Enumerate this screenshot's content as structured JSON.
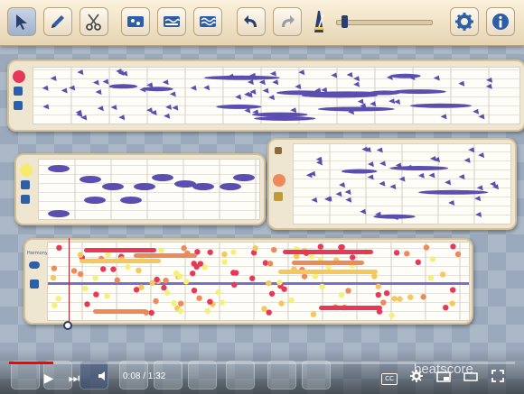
{
  "toolbar": {
    "tools": [
      {
        "name": "select-tool",
        "icon": "arrow-cursor-icon",
        "selected": true
      },
      {
        "name": "pencil-tool",
        "icon": "pencil-icon",
        "selected": false
      },
      {
        "name": "scissors-tool",
        "icon": "scissors-icon",
        "selected": false
      },
      {
        "name": "instrument-tool",
        "icon": "instrument-block-icon",
        "selected": false
      },
      {
        "name": "bass-wave-tool",
        "icon": "wave-block-icon",
        "selected": false
      },
      {
        "name": "wave-tool",
        "icon": "wave-lines-icon",
        "selected": false
      },
      {
        "name": "undo",
        "icon": "undo-icon",
        "selected": false
      },
      {
        "name": "redo",
        "icon": "redo-icon",
        "selected": false
      },
      {
        "name": "tempo",
        "icon": "metronome-icon",
        "selected": false
      }
    ],
    "zoom_level": 0.05,
    "right": [
      {
        "name": "settings",
        "icon": "gear-icon"
      },
      {
        "name": "info",
        "icon": "info-icon"
      }
    ]
  },
  "panels": {
    "violin_color": "#5a4fb0",
    "melody_colors": [
      "#e8385a",
      "#ee8a5a",
      "#f4c85a",
      "#f5f07a"
    ],
    "instrument_label": "Harmony"
  },
  "player": {
    "time": "0:08 / 1:32",
    "progress": 0.087,
    "watermark": "beatscore",
    "cc_label": "CC",
    "icons": [
      "play-icon",
      "skip-next-icon",
      "volume-icon",
      "cc-icon",
      "settings-icon",
      "miniplayer-icon",
      "theater-icon",
      "fullscreen-icon"
    ]
  }
}
